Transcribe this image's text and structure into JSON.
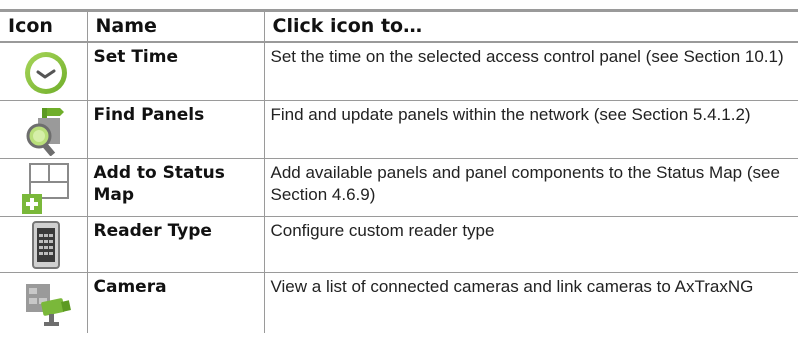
{
  "table": {
    "headers": {
      "icon": "Icon",
      "name": "Name",
      "action": "Click icon to…"
    },
    "rows": [
      {
        "icon": "clock-icon",
        "name": "Set Time",
        "description": "Set the time on the selected access control panel (see Section 10.1)"
      },
      {
        "icon": "find-panels-magnifier-icon",
        "name": "Find Panels",
        "description": "Find and update panels within the network (see Section 5.4.1.2)"
      },
      {
        "icon": "add-to-status-map-icon",
        "name": "Add to Status Map",
        "description": "Add available panels and panel components to the Status Map (see Section 4.6.9)"
      },
      {
        "icon": "card-reader-icon",
        "name": "Reader Type",
        "description": "Configure custom reader type"
      },
      {
        "icon": "camera-icon",
        "name": "Camera",
        "description": "View a list of connected cameras and link cameras to AxTraxNG"
      }
    ]
  },
  "colors": {
    "border": "#9a9a9a",
    "icon_green": "#8dc63f",
    "icon_gray": "#7a7a7a"
  }
}
